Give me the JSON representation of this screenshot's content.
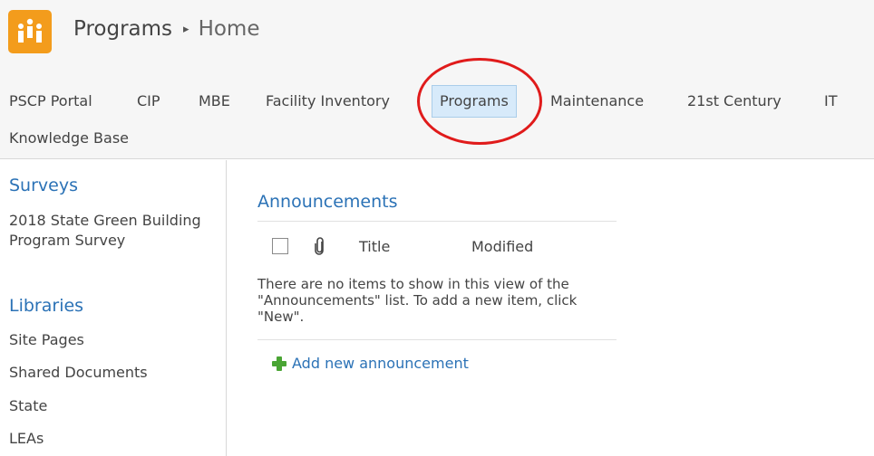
{
  "header": {
    "site_title": "Programs",
    "separator": "▸",
    "page_title": "Home",
    "logo_icon": "people-group-icon",
    "logo_color": "#f39c1c"
  },
  "topnav": {
    "items": [
      {
        "label": "PSCP Portal"
      },
      {
        "label": "CIP"
      },
      {
        "label": "MBE"
      },
      {
        "label": "Facility Inventory"
      },
      {
        "label": "Programs",
        "selected": true
      },
      {
        "label": "Maintenance"
      },
      {
        "label": "21st Century"
      },
      {
        "label": "IT"
      },
      {
        "label": "Knowledge Base"
      }
    ],
    "selected_bg": "#d7eafa",
    "annotation_color": "#e01b1b"
  },
  "leftnav": {
    "surveys_heading": "Surveys",
    "surveys_item": "2018 State Green Building Program Survey",
    "libraries_heading": "Libraries",
    "libraries": [
      "Site Pages",
      "Shared Documents",
      "State",
      "LEAs"
    ],
    "heading_color": "#2b72b6"
  },
  "announcements": {
    "title": "Announcements",
    "columns": {
      "attachment_icon": "paperclip-icon",
      "title": "Title",
      "modified": "Modified"
    },
    "empty_message": "There are no items to show in this view of the \"Announcements\" list. To add a new item, click \"New\".",
    "add_label": "Add new announcement",
    "add_icon": "plus-icon"
  }
}
